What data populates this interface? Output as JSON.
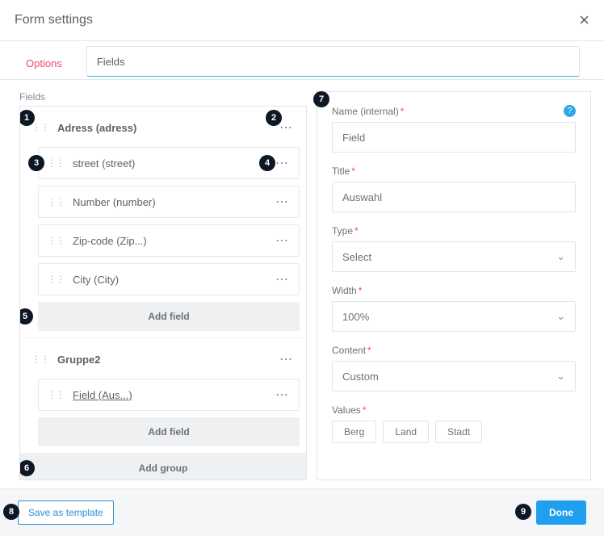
{
  "header": {
    "title": "Form settings"
  },
  "tabs": {
    "options": "Options",
    "fields": "Fields"
  },
  "fields_label": "Fields",
  "tree": {
    "g1": {
      "title": "Adress (adress)",
      "items": [
        "street (street)",
        "Number (number)",
        "Zip-code (Zip...)",
        "City (City)"
      ],
      "add": "Add field"
    },
    "g2": {
      "title": "Gruppe2",
      "items": [
        "Field (Aus...)"
      ],
      "add": "Add field"
    },
    "add_group": "Add group"
  },
  "form": {
    "name_label": "Name (internal)",
    "name_value": "Field",
    "title_label": "Title",
    "title_value": "Auswahl",
    "type_label": "Type",
    "type_value": "Select",
    "width_label": "Width",
    "width_value": "100%",
    "content_label": "Content",
    "content_value": "Custom",
    "values_label": "Values",
    "values": [
      "Berg",
      "Land",
      "Stadt"
    ]
  },
  "footer": {
    "save": "Save as template",
    "done": "Done"
  },
  "badges": {
    "b1": "1",
    "b2": "2",
    "b3": "3",
    "b4": "4",
    "b5": "5",
    "b6": "6",
    "b7": "7",
    "b8": "8",
    "b9": "9"
  }
}
